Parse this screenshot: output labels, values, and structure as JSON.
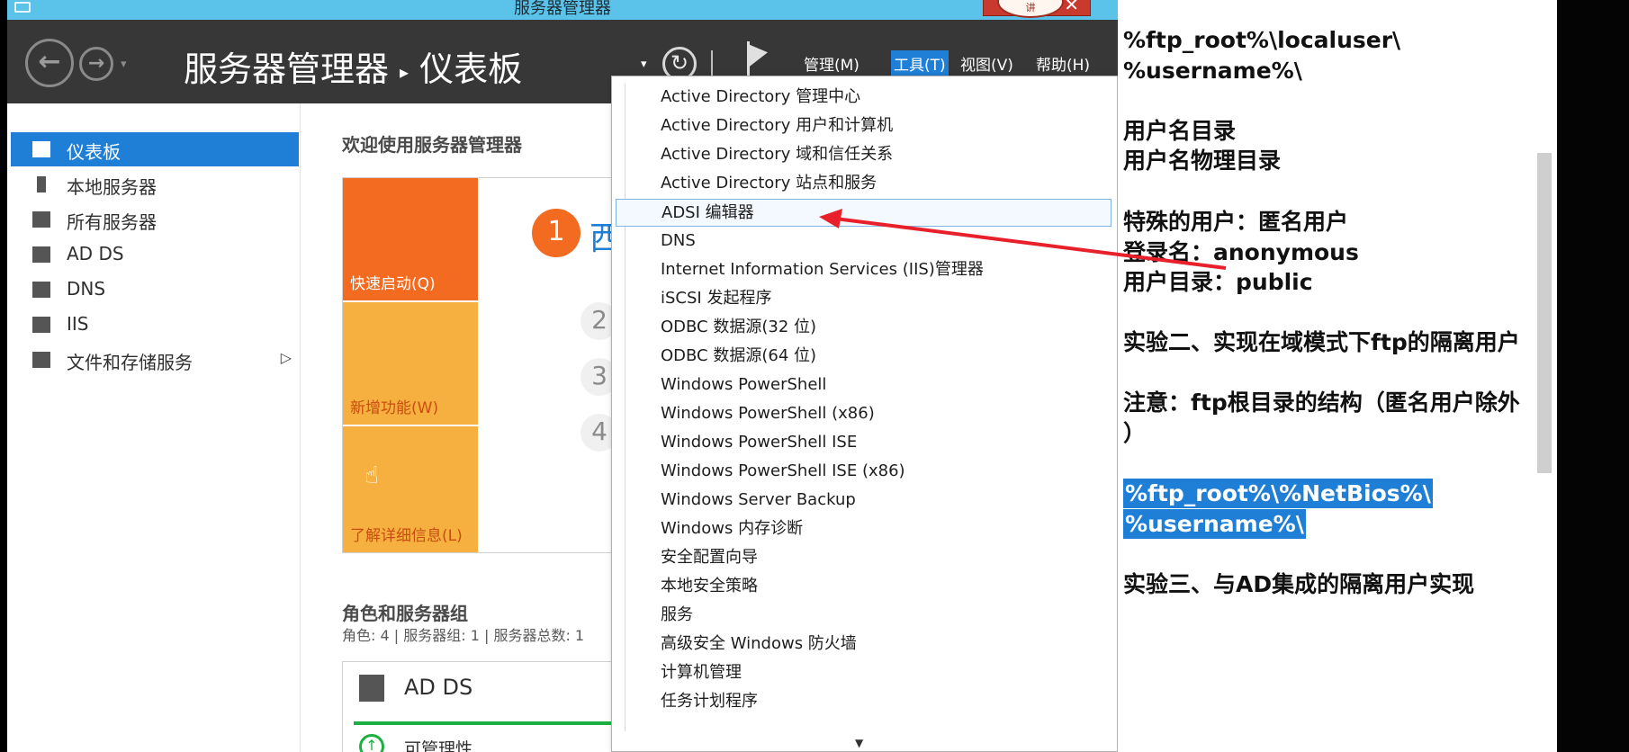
{
  "window": {
    "title": "服务器管理器",
    "close_glyph": "✕",
    "stamp_text": "讲"
  },
  "header": {
    "back_glyph": "←",
    "forward_glyph": "→",
    "nav_drop_glyph": "▾",
    "breadcrumb_root": "服务器管理器",
    "breadcrumb_sep": "▸",
    "breadcrumb_current": "仪表板",
    "drop_glyph": "▾",
    "refresh_glyph": "↻",
    "menus": {
      "manage": "管理(M)",
      "tools": "工具(T)",
      "view": "视图(V)",
      "help": "帮助(H)"
    },
    "accent": "#1f7fd6"
  },
  "sidebar": {
    "items": [
      {
        "label": "仪表板",
        "icon": "dashboard-icon",
        "active": true
      },
      {
        "label": "本地服务器",
        "icon": "server-icon"
      },
      {
        "label": "所有服务器",
        "icon": "servers-icon"
      },
      {
        "label": "AD DS",
        "icon": "ad-ds-icon"
      },
      {
        "label": "DNS",
        "icon": "dns-icon"
      },
      {
        "label": "IIS",
        "icon": "iis-icon"
      },
      {
        "label": "文件和存储服务",
        "icon": "file-storage-icon",
        "arrow": "▷"
      }
    ]
  },
  "main": {
    "welcome_title": "欢迎使用服务器管理器",
    "tiles": {
      "quick": "快速启动(Q)",
      "new": "新增功能(W)",
      "learn": "了解详细信息(L)"
    },
    "steps": {
      "one": "1",
      "one_text": "西",
      "two": "2",
      "three": "3",
      "four": "4"
    },
    "roles_title": "角色和服务器组",
    "roles_sub": "角色: 4 | 服务器组: 1 | 服务器总数: 1",
    "card": {
      "title": "AD DS",
      "manageability": "可管理性",
      "manage_glyph": "↑"
    },
    "cursor_glyph": "☝"
  },
  "tools_menu": {
    "items": [
      "Active Directory 管理中心",
      "Active Directory 用户和计算机",
      "Active Directory 域和信任关系",
      "Active Directory 站点和服务",
      "ADSI 编辑器",
      "DNS",
      "Internet Information Services (IIS)管理器",
      "iSCSI 发起程序",
      "ODBC 数据源(32 位)",
      "ODBC 数据源(64 位)",
      "Windows PowerShell",
      "Windows PowerShell (x86)",
      "Windows PowerShell ISE",
      "Windows PowerShell ISE (x86)",
      "Windows Server Backup",
      "Windows 内存诊断",
      "安全配置向导",
      "本地安全策略",
      "服务",
      "高级安全 Windows 防火墙",
      "计算机管理",
      "任务计划程序"
    ],
    "highlighted_index": 4,
    "scroll_glyph": "▼"
  },
  "notes": {
    "lines": [
      "%ftp_root%\\localuser\\",
      "%username%\\",
      "用户名目录",
      "用户名物理目录",
      "特殊的用户：匿名用户",
      "登录名：anonymous",
      "用户目录：public",
      "实验二、实现在域模式下ftp的隔离用户",
      "注意：ftp根目录的结构（匿名用户除外",
      "）",
      "%ftp_root%\\%NetBios%\\",
      "%username%\\",
      "实验三、与AD集成的隔离用户实现"
    ],
    "annotation_color": "#e8202a"
  }
}
